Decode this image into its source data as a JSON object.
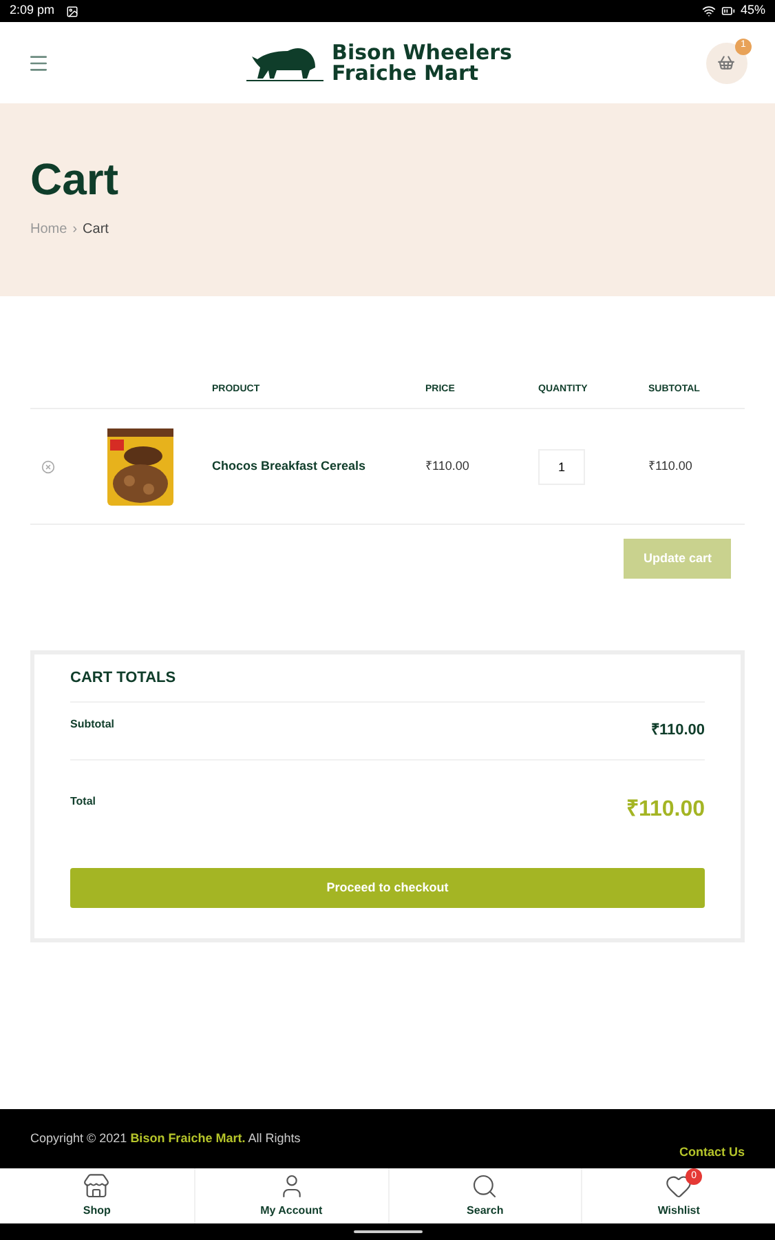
{
  "status_bar": {
    "time": "2:09 pm",
    "battery": "45%"
  },
  "header": {
    "logo_line_1": "Bison Wheelers",
    "logo_line_2": "Fraiche Mart",
    "cart_count": "1"
  },
  "hero": {
    "title": "Cart",
    "breadcrumb": [
      "Home",
      "Cart"
    ],
    "separator": "›"
  },
  "table": {
    "columns": [
      "PRODUCT",
      "PRICE",
      "QUANTITY",
      "SUBTOTAL"
    ],
    "rows": [
      {
        "product": "Chocos Breakfast Cereals",
        "price": "₹110.00",
        "quantity": "1",
        "subtotal": "₹110.00"
      }
    ],
    "update_button": {
      "label": "Update cart",
      "disabled": true
    }
  },
  "totals": {
    "title": "CART TOTALS",
    "subtotal_label": "Subtotal",
    "subtotal": "₹110.00",
    "total_label": "Total",
    "total": "₹110.00",
    "checkout": "Proceed to checkout"
  },
  "footer": {
    "copyright_prefix": "Copyright © 2021 ",
    "brand": "Bison Fraiche Mart.",
    "copyright_suffix": " All Rights",
    "contact": "Contact Us"
  },
  "bottom_nav": [
    {
      "kind": "shop",
      "label": "Shop"
    },
    {
      "kind": "account",
      "label": "My Account"
    },
    {
      "kind": "search",
      "label": "Search"
    },
    {
      "kind": "wishlist",
      "label": "Wishlist",
      "badge": "0"
    }
  ]
}
